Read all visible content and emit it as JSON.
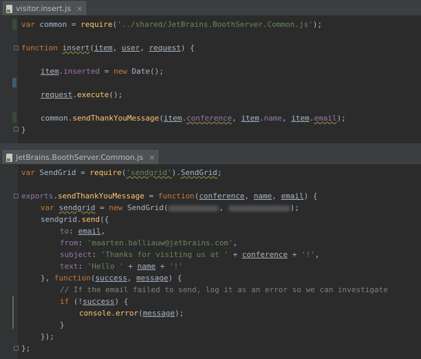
{
  "editor1": {
    "tab_label": "visitor.insert.js",
    "close_glyph": "×",
    "lines": {
      "l1": [
        "var",
        " common = ",
        "require",
        "(",
        "'../shared/JetBrains.BoothServer.Common.js'",
        ");"
      ],
      "l2": [
        "function",
        " ",
        "insert",
        "(",
        "item",
        ", ",
        "user",
        ", ",
        "request",
        ") {"
      ],
      "l3": [
        "item",
        ".",
        "inserted",
        " = ",
        "new",
        " Date();"
      ],
      "l4": [
        "request",
        ".",
        "execute",
        "();"
      ],
      "l5": [
        "common.",
        "sendThankYouMessage",
        "(",
        "item",
        ".",
        "conference",
        ", ",
        "item",
        ".",
        "name",
        ", ",
        "item",
        ".",
        "email",
        ");"
      ],
      "l6": [
        "}"
      ]
    }
  },
  "editor2": {
    "tab_label": "JetBrains.BoothServer.Common.js",
    "close_glyph": "×",
    "lines": {
      "l1": [
        "var",
        " SendGrid = ",
        "require",
        "(",
        "'sendgrid'",
        ").",
        "SendGrid",
        ";"
      ],
      "l2": [
        "exports",
        ".",
        "sendThankYouMessage",
        " = ",
        "function",
        "(",
        "conference",
        ", ",
        "name",
        ", ",
        "email",
        ") {"
      ],
      "l3": [
        "var",
        " ",
        "sendgrid",
        " = ",
        "new",
        " SendGrid(",
        ", ",
        ");"
      ],
      "l4": [
        "sendgrid",
        ".",
        "send",
        "({"
      ],
      "l5": [
        "to",
        ": ",
        "email",
        ","
      ],
      "l6": [
        "from",
        ": ",
        "'maarten.balliauw@jetbrains.com'",
        ","
      ],
      "l7": [
        "subject",
        ": ",
        "'Thanks for visiting us at '",
        " + ",
        "conference",
        " + ",
        "'!'",
        ","
      ],
      "l8": [
        "text",
        ": ",
        "'Hello '",
        " + ",
        "name",
        " + ",
        "'!'"
      ],
      "l9": [
        "}, ",
        "function",
        "(",
        "success",
        ", ",
        "message",
        ") {"
      ],
      "l10": [
        "// If the email failed to send, log it as an error so we can investigate"
      ],
      "l11": [
        "if",
        " (!",
        "success",
        ") {"
      ],
      "l12": [
        "console",
        ".",
        "error",
        "(",
        "message",
        ");"
      ],
      "l13": [
        "}"
      ],
      "l14": [
        "});"
      ],
      "l15": [
        "};"
      ]
    }
  },
  "colors": {
    "background": "#2b2b2b",
    "keyword": "#cc7832",
    "string": "#6a8759",
    "function": "#ffc66d",
    "property": "#9876aa",
    "comment": "#808080",
    "change_marker_green": "#384c38",
    "change_marker_blue": "#3f5b6b"
  }
}
